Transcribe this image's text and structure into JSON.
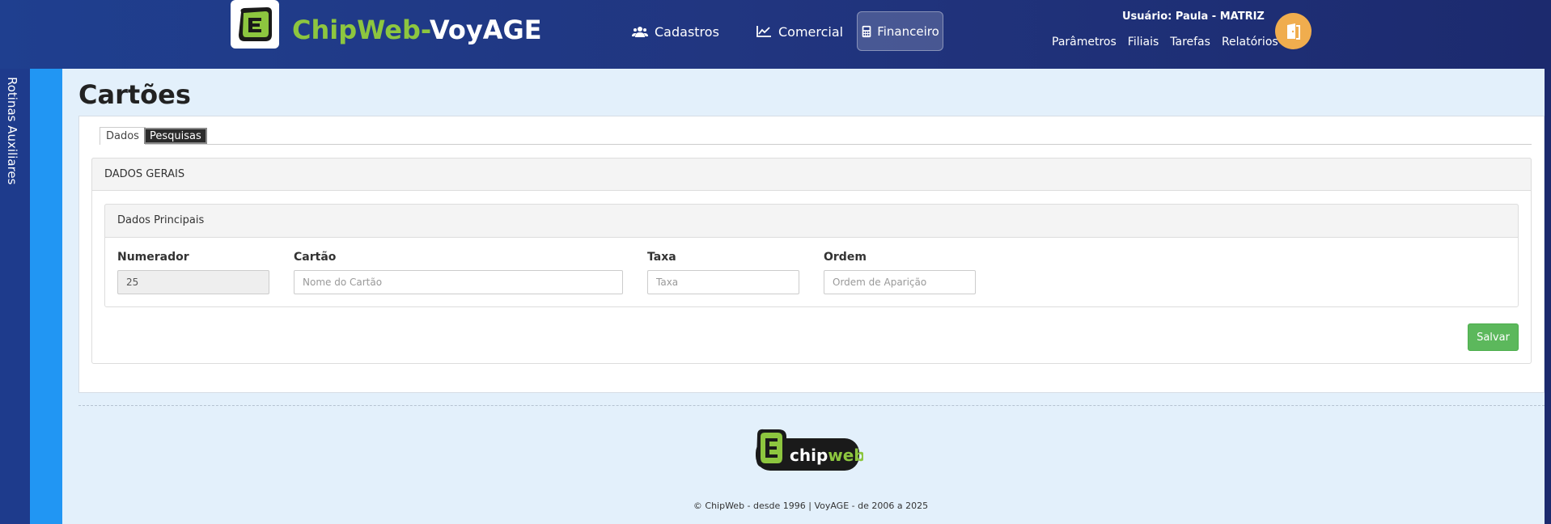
{
  "brand": {
    "name_part1": "ChipWeb-",
    "name_part2": "VoyAGE"
  },
  "nav": {
    "cadastros": "Cadastros",
    "comercial": "Comercial",
    "financeiro": "Financeiro"
  },
  "user": {
    "label": "Usuário: Paula - MATRIZ"
  },
  "top_links": [
    "Parâmetros",
    "Filiais",
    "Tarefas",
    "Relatórios"
  ],
  "sidebar": {
    "label": "Rotinas Auxiliares"
  },
  "page": {
    "title": "Cartões"
  },
  "tabs": [
    {
      "label": "Dados",
      "active": true
    },
    {
      "label": "Pesquisas",
      "active": false
    }
  ],
  "sections": {
    "general": "DADOS GERAIS",
    "main": "Dados Principais"
  },
  "form": {
    "numerador": {
      "label": "Numerador",
      "value": "25"
    },
    "cartao": {
      "label": "Cartão",
      "placeholder": "Nome do Cartão"
    },
    "taxa": {
      "label": "Taxa",
      "placeholder": "Taxa"
    },
    "ordem": {
      "label": "Ordem",
      "placeholder": "Ordem de Aparição"
    }
  },
  "actions": {
    "save": "Salvar"
  },
  "footer": {
    "logo_text": "chipweb",
    "copyright": "© ChipWeb - desde 1996 | VoyAGE - de 2006 a 2025"
  },
  "colors": {
    "header": "#21357f",
    "brand_green": "#8dc63f",
    "sidebar_blue": "#2196f3",
    "save_green": "#5cb85c",
    "exit_orange": "#f0ad4e"
  },
  "icons": {
    "cadastros": "users-icon",
    "comercial": "line-chart-icon",
    "financeiro": "calculator-icon",
    "exit": "exit-door-icon"
  }
}
